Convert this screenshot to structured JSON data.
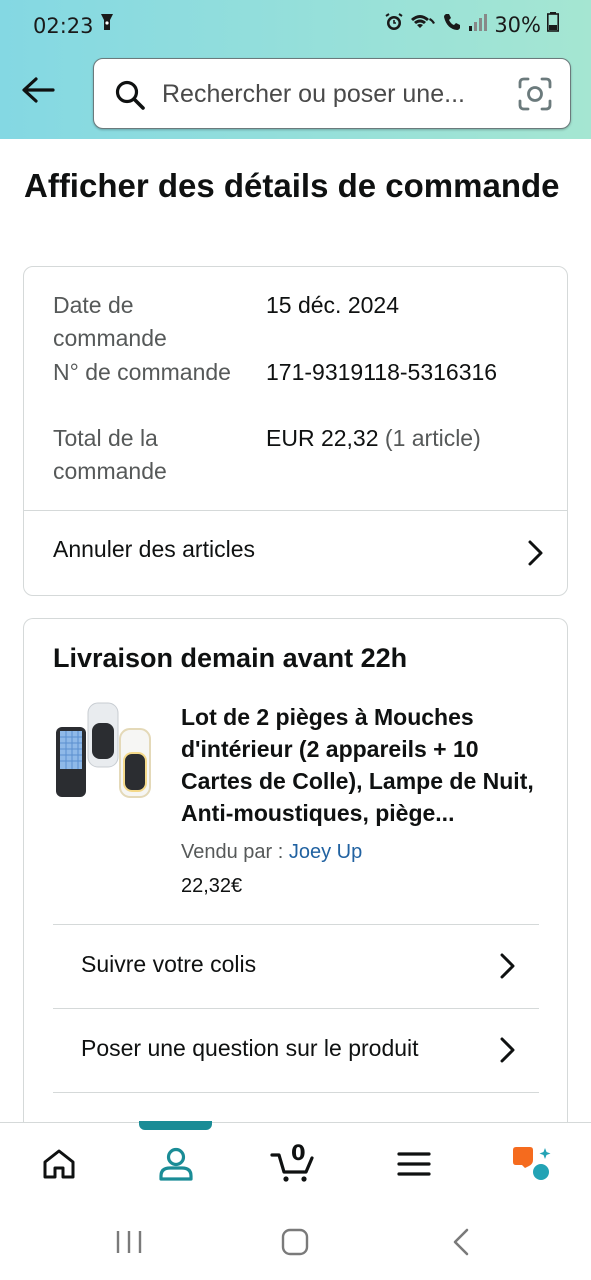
{
  "status_bar": {
    "time": "02:23",
    "battery": "30%"
  },
  "header": {
    "search_placeholder": "Rechercher ou poser une..."
  },
  "page": {
    "title": "Afficher des détails de commande"
  },
  "order_summary": {
    "date_label": "Date de commande",
    "date_value": "15 déc. 2024",
    "number_label": "N° de commande",
    "number_value": "171-9319118-5316316",
    "total_label": "Total de la commande",
    "total_value": "EUR 22,32",
    "total_items": "(1 article)",
    "cancel_label": "Annuler des articles"
  },
  "shipment": {
    "heading": "Livraison demain avant 22h",
    "product_title": "Lot de 2 pièges à Mouches d'intérieur (2 appareils + 10 Cartes de Colle), Lampe de Nuit, Anti-moustiques, piège...",
    "sold_by_label": "Vendu par  : ",
    "seller": "Joey Up",
    "price": "22,32€",
    "track_label": "Suivre votre colis",
    "question_label": "Poser une question sur le produit"
  },
  "bottom_nav": {
    "cart_count": "0"
  },
  "colors": {
    "header_gradient_start": "#84d8e3",
    "header_gradient_end": "#a5e6d2",
    "accent": "#1a8c96",
    "link": "#2162a1",
    "ai_orange": "#f56b1e",
    "ai_teal": "#23a3b5"
  }
}
